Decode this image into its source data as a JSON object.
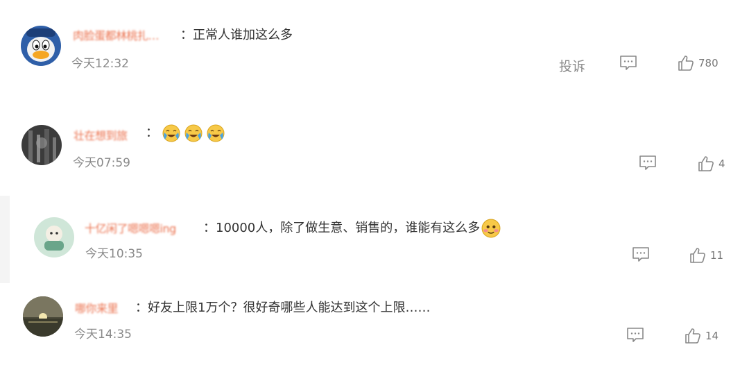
{
  "report_label": "投诉",
  "comments": [
    {
      "username": "肉脸蛋都林桃扎…",
      "colon": "：",
      "text": "正常人谁加这么多",
      "time": "今天12:32",
      "likes": "780",
      "avatar_icon": "donald-duck-avatar"
    },
    {
      "username": "壮在想到旅",
      "colon": "：",
      "text": "",
      "emojis": [
        "crying-laughing-emoji",
        "crying-laughing-emoji",
        "crying-laughing-emoji"
      ],
      "time": "今天07:59",
      "likes": "4",
      "avatar_icon": "dark-photo-avatar"
    },
    {
      "username": "十亿闲了嗯嗯嗯ing",
      "colon": "：",
      "text": "10000人，除了做生意、销售的，谁能有这么多",
      "emoji_end": "blushing-emoji",
      "time": "今天10:35",
      "likes": "11",
      "avatar_icon": "cartoon-avatar"
    },
    {
      "username": "哪你来里",
      "colon": "：",
      "text": "好友上限1万个？很好奇哪些人能达到这个上限……",
      "time": "今天14:35",
      "likes": "14",
      "avatar_icon": "sunset-photo-avatar"
    }
  ]
}
